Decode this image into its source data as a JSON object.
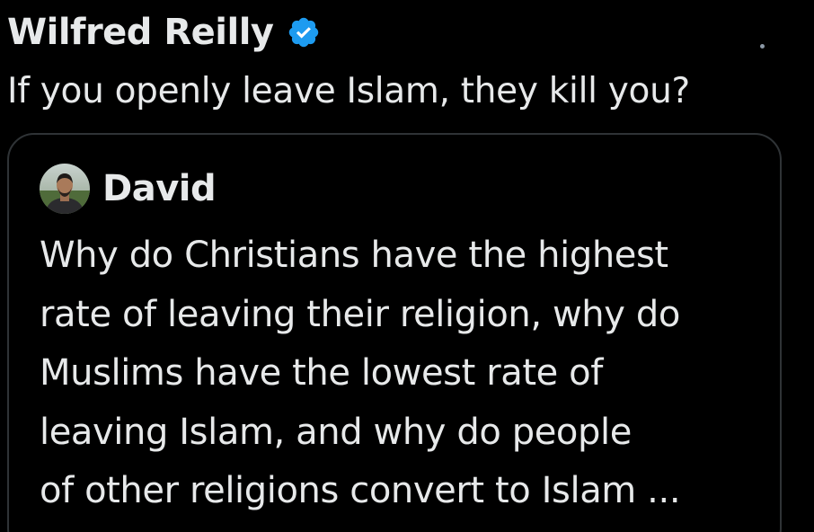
{
  "tweet": {
    "author_name": "Wilfred Reilly",
    "verified": true,
    "text": "If you openly leave Islam, they kill you?"
  },
  "quoted_tweet": {
    "author_name": "David",
    "lines": [
      "Why do Christians have the highest",
      "rate of leaving their religion, why do",
      "Muslims have the lowest rate of",
      "leaving Islam, and why do people",
      "of other religions convert to Islam ..."
    ]
  },
  "colors": {
    "background": "#000000",
    "text": "#e7e9ea",
    "verified_badge": "#1d9bf0",
    "card_border": "#2f3336"
  },
  "icons": {
    "verified": "verified-badge-icon"
  }
}
